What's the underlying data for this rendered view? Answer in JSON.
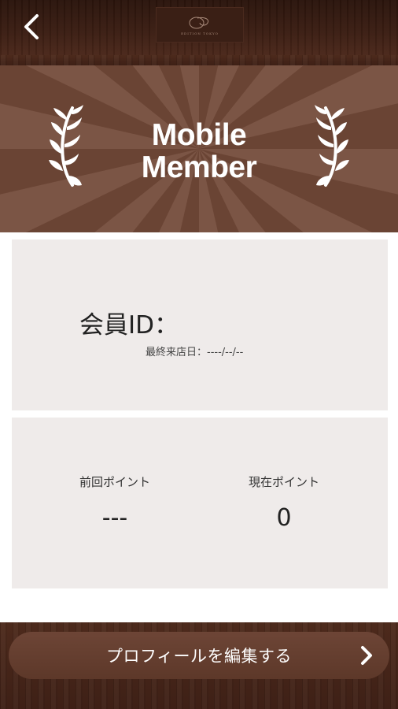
{
  "header": {
    "back_icon": "chevron-left-icon",
    "logo_text": "EDITION TOKYO"
  },
  "banner": {
    "title_line1": "Mobile",
    "title_line2": "Member",
    "left_icon": "laurel-left-icon",
    "right_icon": "laurel-right-icon"
  },
  "member_card": {
    "member_id_label": "会員ID：",
    "last_visit": "最終来店日：----/--/--"
  },
  "points": {
    "previous_label": "前回ポイント",
    "previous_value": "---",
    "current_label": "現在ポイント",
    "current_value": "0"
  },
  "footer": {
    "edit_profile_label": "プロフィールを編集する",
    "chevron_icon": "chevron-right-icon"
  },
  "colors": {
    "wood_dark": "#3e2016",
    "banner_brown": "#6b4536",
    "card_bg": "#efebea",
    "button_brown": "#6d4536"
  }
}
